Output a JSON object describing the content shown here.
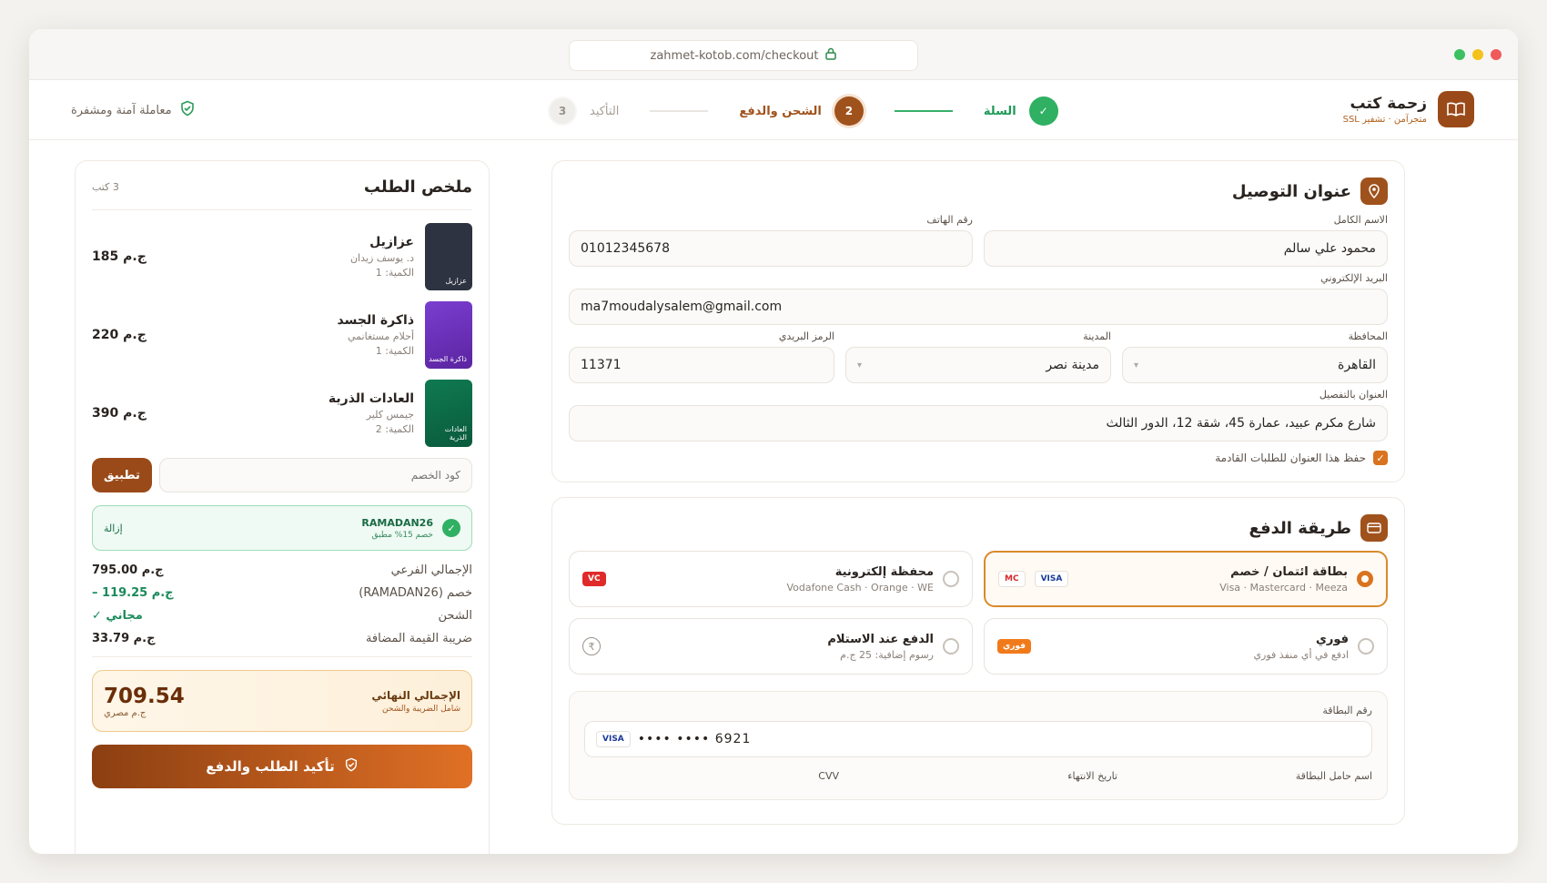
{
  "browser": {
    "url": "zahmet-kotob.com/checkout"
  },
  "brand": {
    "name": "زحمة كتب",
    "tagline": "متجرآمن · تشفير SSL"
  },
  "steps": [
    {
      "num": "✓",
      "label": "السلة",
      "state": "done"
    },
    {
      "num": "2",
      "label": "الشحن والدفع",
      "state": "active"
    },
    {
      "num": "3",
      "label": "التأكيد",
      "state": "pending"
    }
  ],
  "secure_label": "معاملة آمنة ومشفرة",
  "address": {
    "title": "عنوان التوصيل",
    "fullname_label": "الاسم الكامل",
    "fullname": "محمود علي سالم",
    "phone_label": "رقم الهاتف",
    "phone": "01012345678",
    "email_label": "البريد الإلكتروني",
    "email": "ma7moudalysalem@gmail.com",
    "gov_label": "المحافظة",
    "gov": "القاهرة",
    "city_label": "المدينة",
    "city": "مدينة نصر",
    "zip_label": "الرمز البريدي",
    "zip": "11371",
    "detail_label": "العنوان بالتفصيل",
    "detail": "شارع مكرم عبيد، عمارة 45، شقة 12، الدور الثالث",
    "save_label": "حفظ هذا العنوان للطلبات القادمة"
  },
  "payment": {
    "title": "طريقة الدفع",
    "options": [
      {
        "title": "بطاقة ائتمان / خصم",
        "sub": "Visa · Mastercard · Meeza",
        "selected": true,
        "badges": [
          "VISA",
          "MC"
        ]
      },
      {
        "title": "محفظة إلكترونية",
        "sub": "Vodafone Cash · Orange · WE",
        "selected": false,
        "badges": [
          "VC"
        ]
      },
      {
        "title": "فوري",
        "sub": "ادفع في أي منفذ فوري",
        "selected": false,
        "badges": [
          "فوري"
        ]
      },
      {
        "title": "الدفع عند الاستلام",
        "sub": "رسوم إضافية: 25 ج.م",
        "selected": false,
        "badges": [
          "₹"
        ]
      }
    ],
    "card_number_label": "رقم البطاقة",
    "card_number": "•••• •••• 6921",
    "card_brand": "VISA",
    "holder_label": "اسم حامل البطاقة",
    "expiry_label": "تاريخ الانتهاء",
    "cvv_label": "CVV"
  },
  "summary": {
    "title": "ملخص الطلب",
    "count": "3 كتب",
    "books": [
      {
        "title": "عزازيل",
        "author": "د. يوسف زيدان",
        "qty": "الكمية: 1",
        "price": "185 ج.م",
        "cover": "عزازيل",
        "color": "#2d3340"
      },
      {
        "title": "ذاكرة الجسد",
        "author": "أحلام مستغانمي",
        "qty": "الكمية: 1",
        "price": "220 ج.م",
        "cover": "ذاكرة الجسد",
        "color": "#6b2fb0"
      },
      {
        "title": "العادات الذرية",
        "author": "جيمس كلير",
        "qty": "الكمية: 2",
        "price": "390 ج.م",
        "cover": "العادات الذرية",
        "color": "#0d6b47"
      }
    ],
    "coupon_placeholder": "كود الخصم",
    "apply_label": "تطبيق",
    "coupon_code": "RAMADAN26",
    "coupon_note": "خصم 15% مطبق",
    "remove_label": "إزالة",
    "rows": [
      {
        "label": "الإجمالي الفرعي",
        "value": "795.00 ج.م",
        "color": "#2a2420"
      },
      {
        "label": "خصم (RAMADAN26)",
        "value": "– 119.25 ج.م",
        "color": "#1a8a5a"
      },
      {
        "label": "الشحن",
        "value": "مجاني ✓",
        "color": "#1a8a5a"
      },
      {
        "label": "ضريبة القيمة المضافة",
        "value": "33.79 ج.م",
        "color": "#2a2420"
      }
    ],
    "total_label": "الإجمالي النهائي",
    "total_note": "شامل الضريبة والشحن",
    "total_value": "709.54",
    "total_currency": "ج.م مصري",
    "confirm_label": "تأكيد الطلب والدفع"
  }
}
